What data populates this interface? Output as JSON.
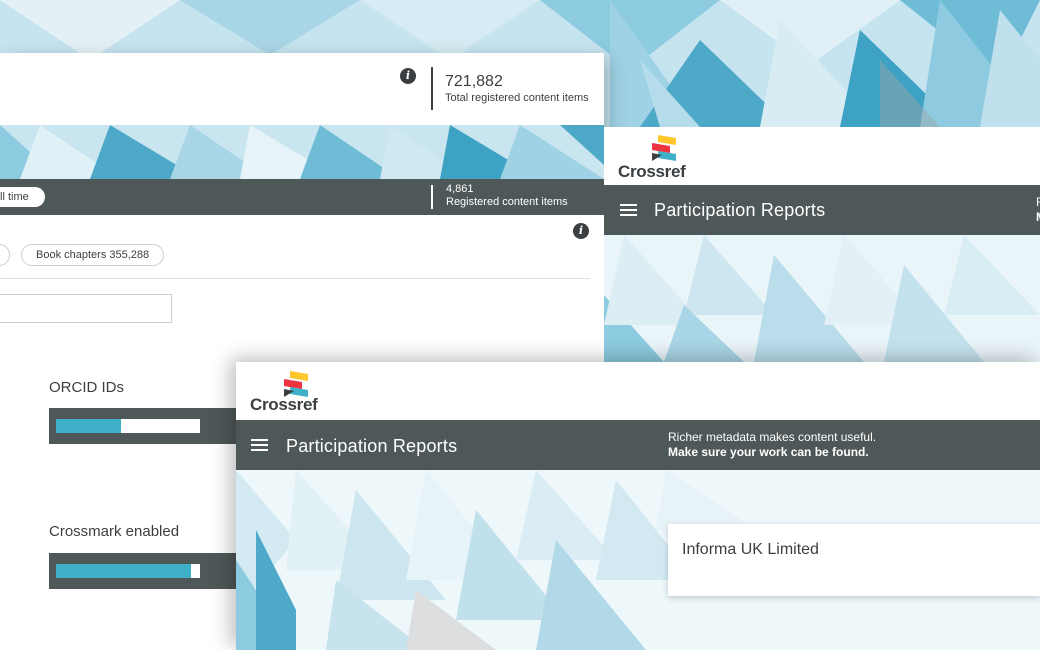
{
  "colors": {
    "dark_bar": "#4f5858",
    "accent_teal": "#3eb1c8",
    "text_dark": "#3b3f42",
    "logo_red": "#ef3340",
    "logo_yellow": "#ffc72c",
    "logo_teal": "#3eb1c8"
  },
  "back_panel": {
    "total": {
      "value": "721,882",
      "label": "Total registered content items"
    },
    "filter_label": "ll time",
    "registered": {
      "value": "4,861",
      "label": "Registered content items"
    },
    "pill_book_chapters": "Book chapters 355,288",
    "search": {
      "value": ""
    },
    "metrics": [
      {
        "label": "ORCID IDs",
        "fraction": 0.45
      },
      {
        "label": "Crossmark enabled",
        "fraction": 0.94
      }
    ],
    "info_icon": "info-icon"
  },
  "right_panel": {
    "logo_text": "Crossref",
    "nav_title": "Participation Reports",
    "cut_line1": "R",
    "cut_line2": "M"
  },
  "front_panel": {
    "logo_text": "Crossref",
    "nav_title": "Participation Reports",
    "tagline_line1": "Richer metadata makes content useful.",
    "tagline_line2": "Make sure your work can be found.",
    "member_name": "Informa UK Limited"
  }
}
